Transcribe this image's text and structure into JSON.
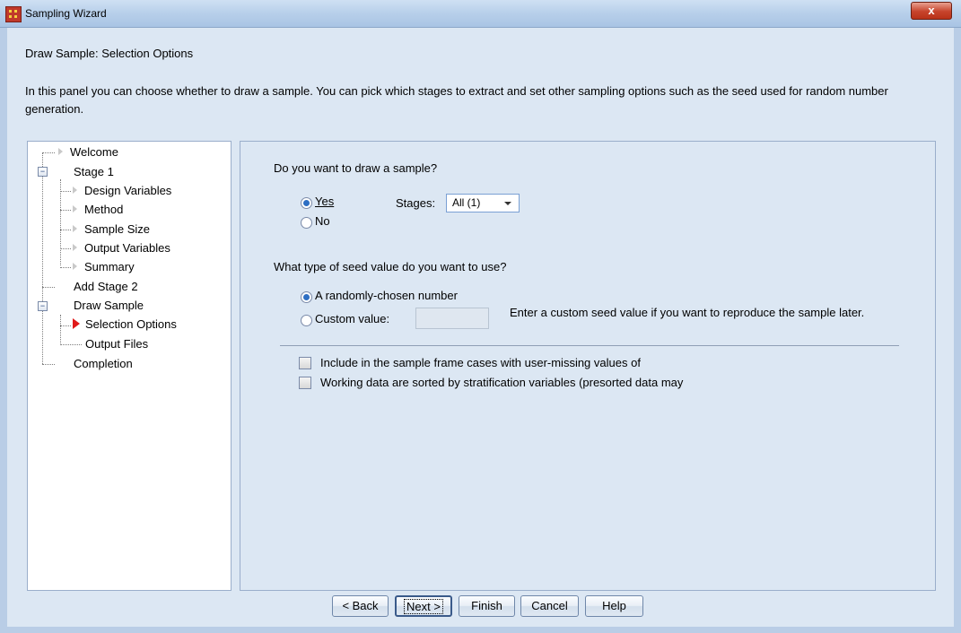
{
  "window": {
    "title": "Sampling Wizard",
    "close_label": "x"
  },
  "panel": {
    "title": "Draw Sample: Selection Options",
    "description": "In this panel you can choose whether to draw  a sample. You can pick which stages to extract and set other sampling options such as the seed used for random number generation."
  },
  "tree": {
    "items": [
      {
        "label": "Welcome"
      },
      {
        "label": "Stage 1"
      },
      {
        "label": "Design Variables"
      },
      {
        "label": "Method"
      },
      {
        "label": "Sample Size"
      },
      {
        "label": "Output Variables"
      },
      {
        "label": "Summary"
      },
      {
        "label": "Add Stage 2"
      },
      {
        "label": "Draw Sample"
      },
      {
        "label": "Selection Options",
        "active": true
      },
      {
        "label": "Output Files"
      },
      {
        "label": "Completion"
      }
    ]
  },
  "draw": {
    "question": "Do you want to draw a sample?",
    "yes_label": "Yes",
    "no_label": "No",
    "selected": "Yes",
    "stages_label": "Stages:",
    "stages_value": "All (1)"
  },
  "seed": {
    "question": "What type of seed value do you want to use?",
    "random_label": "A randomly-chosen number",
    "custom_label": "Custom value:",
    "custom_value": "",
    "hint": "Enter a custom seed value if you want to reproduce the sample later.",
    "selected": "A randomly-chosen number"
  },
  "options": {
    "include_missing_label": "Include in the sample frame cases with user-missing values of",
    "include_missing_checked": false,
    "sorted_label": "Working data are sorted by stratification variables (presorted data may",
    "sorted_checked": false
  },
  "buttons": {
    "back": "< Back",
    "next": "Next >",
    "finish": "Finish",
    "cancel": "Cancel",
    "help": "Help"
  }
}
